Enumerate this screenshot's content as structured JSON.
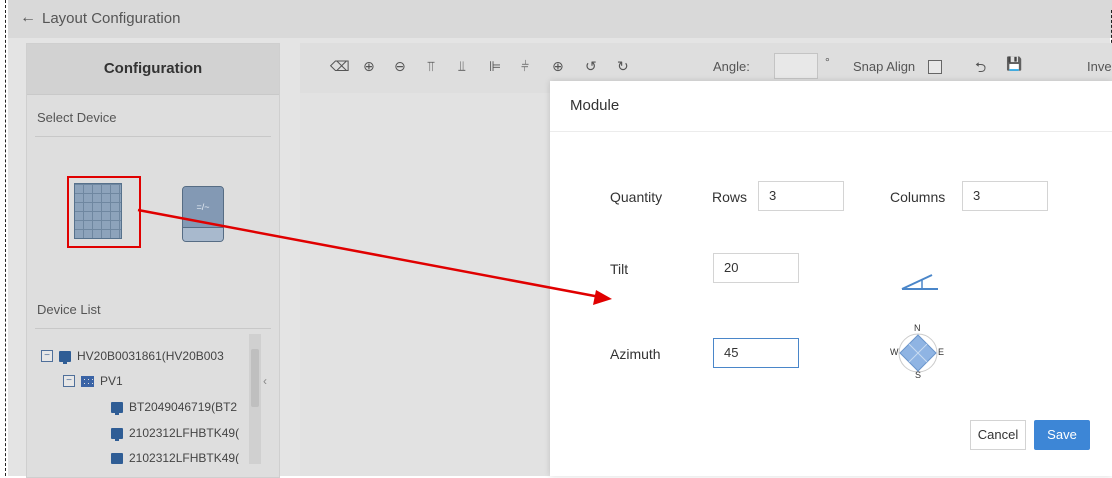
{
  "header": {
    "back_arrow": "←",
    "title": "Layout Configuration"
  },
  "config_panel": {
    "title": "Configuration",
    "select_device_label": "Select Device",
    "devices": [
      {
        "name": "module",
        "icon": "solar-module-icon"
      },
      {
        "name": "inverter",
        "icon": "inverter-icon",
        "glyph": "=/~"
      }
    ],
    "device_list_label": "Device List",
    "tree": [
      {
        "label": "HV20B0031861(HV20B003",
        "expander": "−",
        "icon": "device-icon"
      },
      {
        "label": "PV1",
        "expander": "−",
        "icon": "pv-array-icon"
      },
      {
        "label": "BT2049046719(BT2",
        "icon": "device-icon"
      },
      {
        "label": "2102312LFHBTK49(",
        "icon": "device-icon"
      },
      {
        "label": "2102312LFHBTK49(",
        "icon": "device-icon"
      }
    ],
    "collapse_glyph": "‹"
  },
  "toolbar": {
    "tools": [
      {
        "name": "eraser-icon",
        "glyph": "⌫"
      },
      {
        "name": "zoom-in-icon",
        "glyph": "⊕"
      },
      {
        "name": "zoom-out-icon",
        "glyph": "⊖"
      },
      {
        "name": "align-top-icon",
        "glyph": "⫪"
      },
      {
        "name": "align-middle-icon",
        "glyph": "⫫"
      },
      {
        "name": "align-left-icon",
        "glyph": "⊫"
      },
      {
        "name": "align-bottom-icon",
        "glyph": "⫩"
      },
      {
        "name": "align-center-icon",
        "glyph": "⊕"
      },
      {
        "name": "rotate-left-icon",
        "glyph": "↺"
      },
      {
        "name": "rotate-right-icon",
        "glyph": "↻"
      }
    ],
    "angle_label": "Angle:",
    "angle_value": "",
    "degree_symbol": "°",
    "snap_align_label": "Snap Align",
    "undo_glyph": "⮌",
    "save_glyph": "💾",
    "inverter_label": "Inve"
  },
  "modal": {
    "title": "Module",
    "quantity_label": "Quantity",
    "rows_label": "Rows",
    "rows_value": "3",
    "columns_label": "Columns",
    "columns_value": "3",
    "tilt_label": "Tilt",
    "tilt_value": "20",
    "azimuth_label": "Azimuth",
    "azimuth_value": "45",
    "compass": {
      "n": "N",
      "s": "S",
      "e": "E",
      "w": "W"
    },
    "cancel_label": "Cancel",
    "save_label": "Save"
  },
  "colors": {
    "accent": "#3d86d6",
    "highlight_red": "#e00000",
    "overlay_gray": "#e4e4e4"
  }
}
